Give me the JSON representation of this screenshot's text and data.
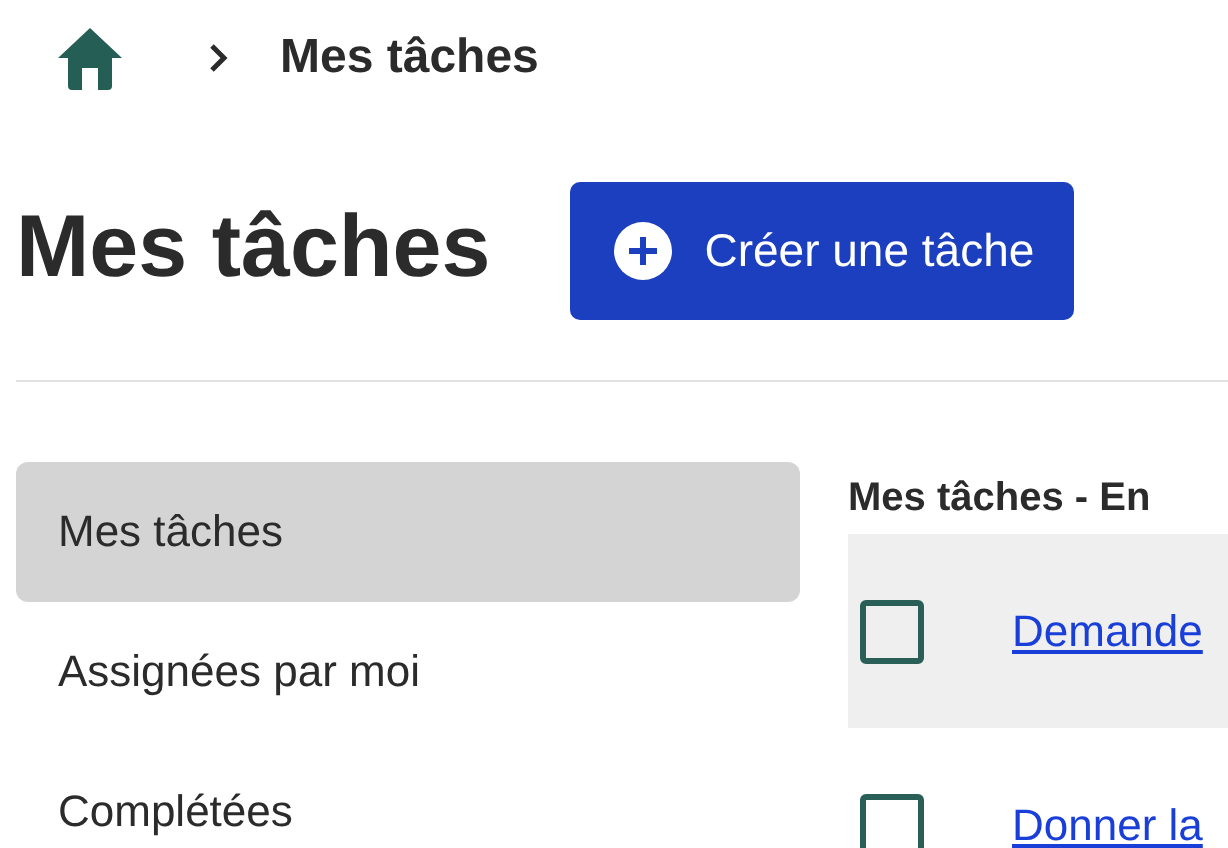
{
  "breadcrumb": {
    "current": "Mes tâches"
  },
  "title": "Mes tâches",
  "create_button": {
    "label": "Créer une tâche"
  },
  "sidebar": {
    "items": [
      {
        "label": "Mes tâches",
        "selected": true
      },
      {
        "label": "Assignées par moi",
        "selected": false
      },
      {
        "label": "Complétées",
        "selected": false
      }
    ]
  },
  "task_list": {
    "heading": "Mes tâches - En",
    "rows": [
      {
        "title": "Demande",
        "checked": false,
        "selected": true
      },
      {
        "title": "Donner la",
        "checked": false,
        "selected": false
      }
    ]
  }
}
